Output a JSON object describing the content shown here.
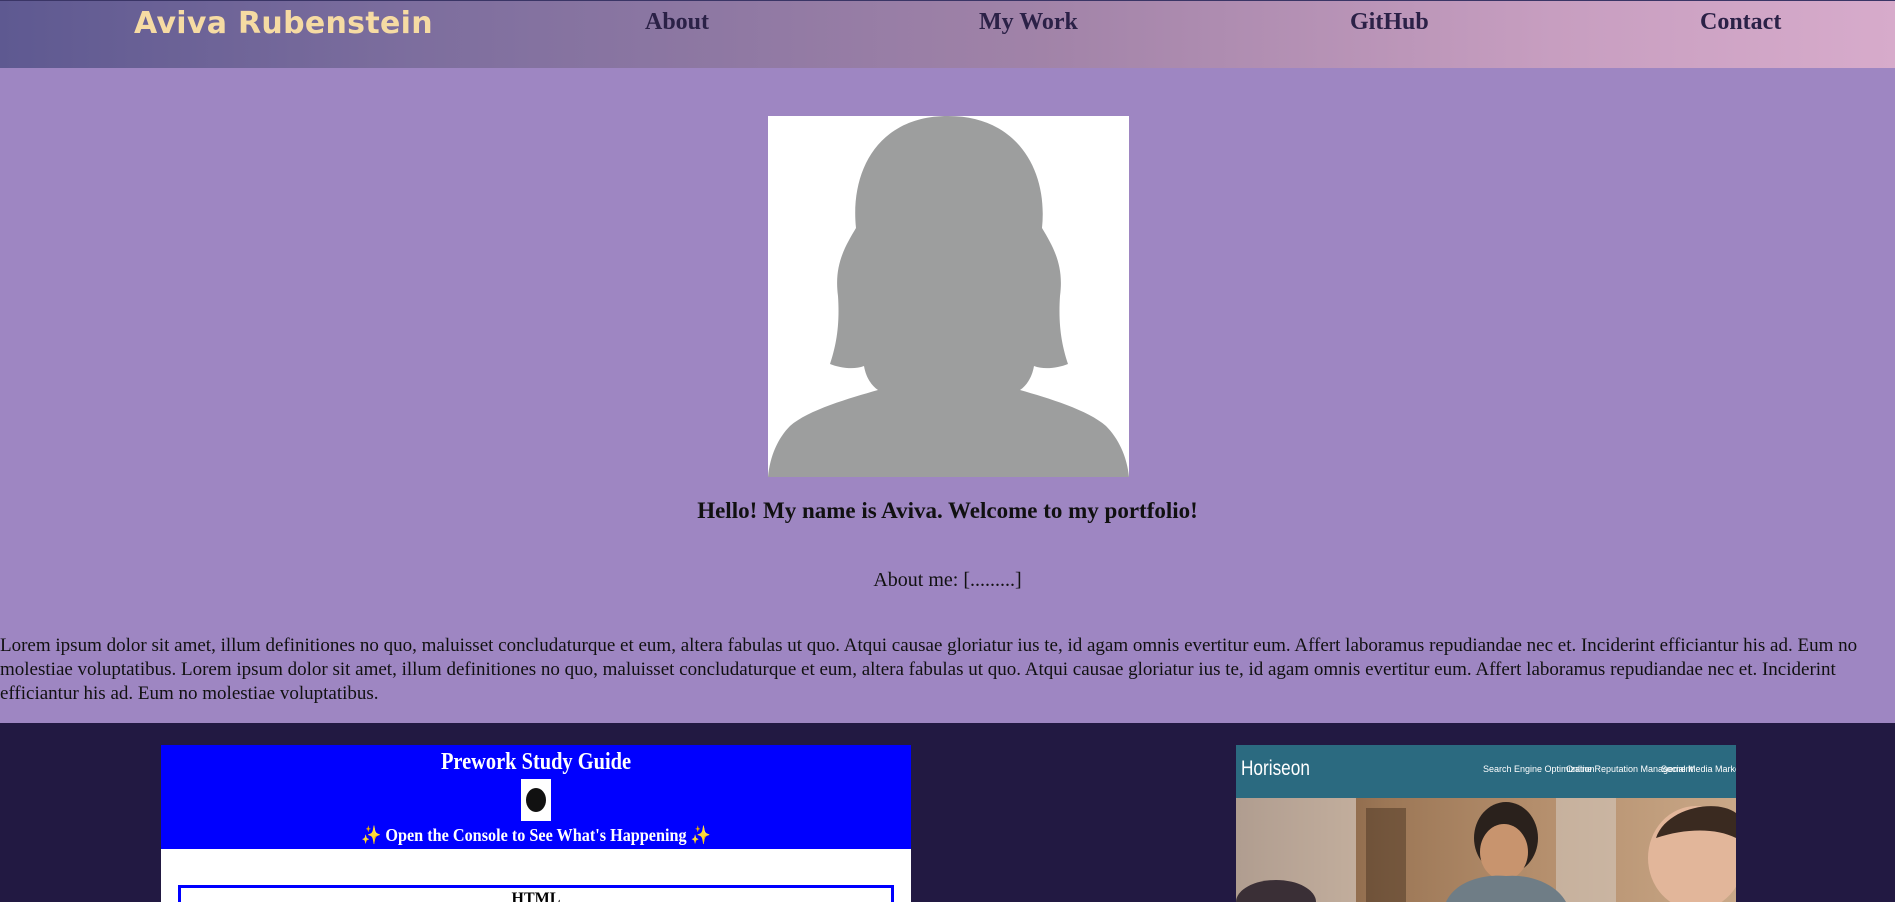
{
  "header": {
    "brand": "Aviva Rubenstein",
    "nav": [
      {
        "label": "About"
      },
      {
        "label": "My Work"
      },
      {
        "label": "GitHub"
      },
      {
        "label": "Contact"
      }
    ]
  },
  "about": {
    "portrait_icon": "person-silhouette",
    "greeting": "Hello! My name is Aviva. Welcome to my portfolio!",
    "about_me": "About me: [.........]",
    "lorem": "Lorem ipsum dolor sit amet, illum definitiones no quo, maluisset concludaturque et eum, altera fabulas ut quo. Atqui causae gloriatur ius te, id agam omnis evertitur eum. Affert laboramus repudiandae nec et. Inciderint efficiantur his ad. Eum no molestiae voluptatibus. Lorem ipsum dolor sit amet, illum definitiones no quo, maluisset concludaturque et eum, altera fabulas ut quo. Atqui causae gloriatur ius te, id agam omnis evertitur eum. Affert laboramus repudiandae nec et. Inciderint efficiantur his ad. Eum no molestiae voluptatibus."
  },
  "work": {
    "prework": {
      "title": "Prework Study Guide",
      "subtitle": "Open the Console to See What's Happening",
      "spark": "✨",
      "box_label": "HTML"
    },
    "horiseon": {
      "logo": "Horiseon",
      "nav": [
        "Search Engine Optimization",
        "Online Reputation Management",
        "Social Media Marketing"
      ]
    }
  },
  "colors": {
    "header_gradient_start": "#5e5991",
    "header_gradient_end": "#d7abcb",
    "brand": "#f6dba3",
    "about_bg": "#9e86c2",
    "work_bg": "#221942",
    "prework_blue": "#0000ff",
    "horiseon_teal": "#2b6a80"
  }
}
